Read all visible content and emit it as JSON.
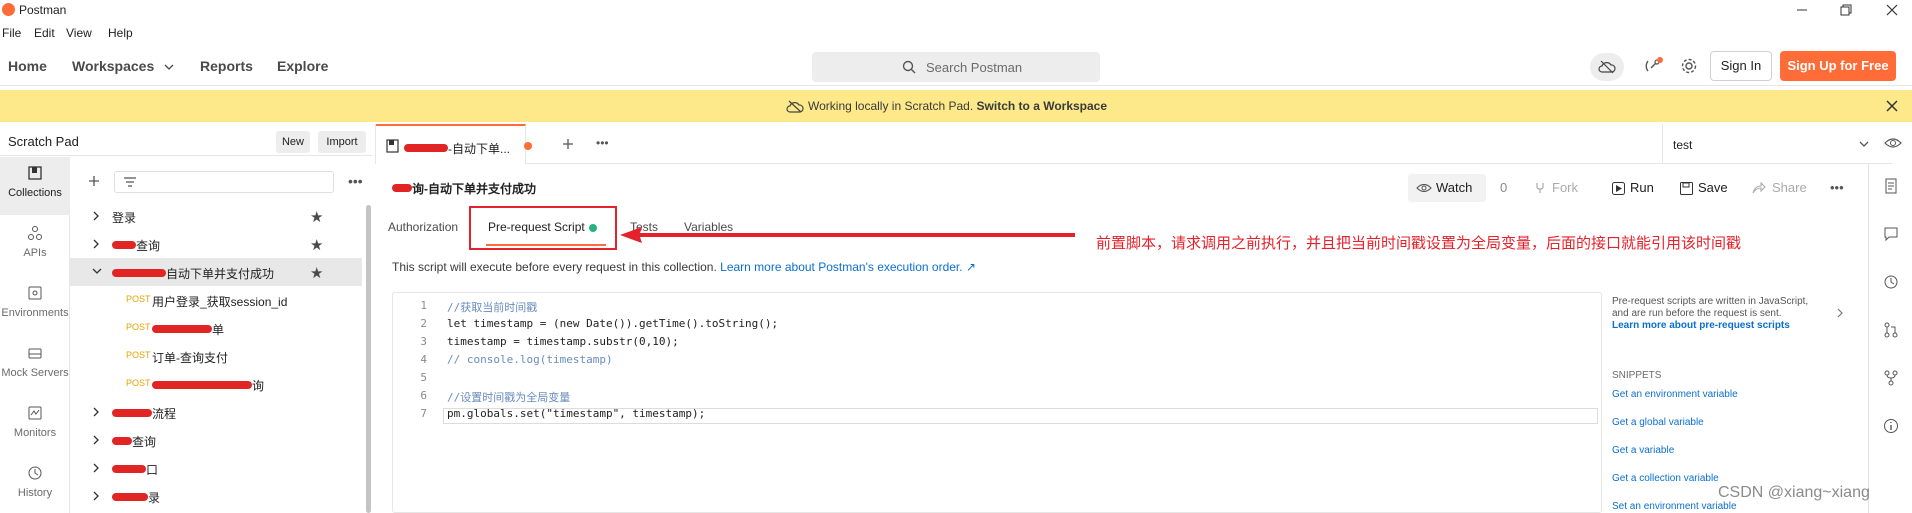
{
  "window": {
    "title": "Postman",
    "menu": [
      "File",
      "Edit",
      "View",
      "Help"
    ]
  },
  "header": {
    "nav": [
      "Home",
      "Workspaces",
      "Reports",
      "Explore"
    ],
    "search_placeholder": "Search Postman",
    "sign_in": "Sign In",
    "sign_up": "Sign Up for Free",
    "brand_color": "#ff6c37"
  },
  "banner": {
    "text": "Working locally in Scratch Pad.",
    "link": "Switch to a Workspace"
  },
  "sidebar": {
    "title": "Scratch Pad",
    "new_label": "New",
    "import_label": "Import",
    "rail": [
      "Collections",
      "APIs",
      "Environments",
      "Mock Servers",
      "Monitors",
      "History"
    ],
    "tree": [
      {
        "label": "登录",
        "expanded": false,
        "starred": true
      },
      {
        "label": "查询",
        "redacted_prefix": true,
        "expanded": false,
        "starred": true
      },
      {
        "label": "自动下单并支付成功",
        "redacted_prefix": true,
        "expanded": true,
        "starred": true,
        "selected": true
      },
      {
        "label": "用户登录_获取session_id",
        "method": "POST"
      },
      {
        "label": "单",
        "redacted_prefix": true,
        "method": "POST"
      },
      {
        "label": "订单-查询支付",
        "method": "POST"
      },
      {
        "label": "询",
        "redacted_prefix": true,
        "method": "POST"
      },
      {
        "label": "流程",
        "redacted_prefix": true,
        "expanded": false
      },
      {
        "label": "查询",
        "redacted_prefix": true,
        "expanded": false
      },
      {
        "label": "口",
        "redacted_prefix": true,
        "expanded": false
      },
      {
        "label": "录",
        "redacted_prefix": true,
        "expanded": false
      }
    ]
  },
  "tabs": {
    "active_label": "-自动下单...",
    "environment": "test"
  },
  "collection": {
    "name": "询-自动下单并支付成功",
    "watch": "Watch",
    "watch_count": "0",
    "fork": "Fork",
    "run": "Run",
    "save": "Save",
    "share": "Share"
  },
  "subtabs": [
    "Authorization",
    "Pre-request Script",
    "Tests",
    "Variables"
  ],
  "annotation": "前置脚本，请求调用之前执行，并且把当前时间戳设置为全局变量，后面的接口就能引用该时间戳",
  "description": {
    "text": "This script will execute before every request in this collection.",
    "link": "Learn more about Postman's execution order. ↗"
  },
  "editor": {
    "lines": [
      "//获取当前时间戳",
      "let timestamp = (new Date()).getTime().toString();",
      "timestamp = timestamp.substr(0,10);",
      "// console.log(timestamp)",
      "",
      "//设置时间戳为全局变量",
      "pm.globals.set(\"timestamp\", timestamp);"
    ]
  },
  "help": {
    "text": "Pre-request scripts are written in JavaScript, and are run before the request is sent.",
    "link": "Learn more about pre-request scripts",
    "snippets_title": "SNIPPETS",
    "snippets": [
      "Get an environment variable",
      "Get a global variable",
      "Get a variable",
      "Get a collection variable",
      "Set an environment variable"
    ]
  },
  "watermark": "CSDN @xiang~xiang"
}
